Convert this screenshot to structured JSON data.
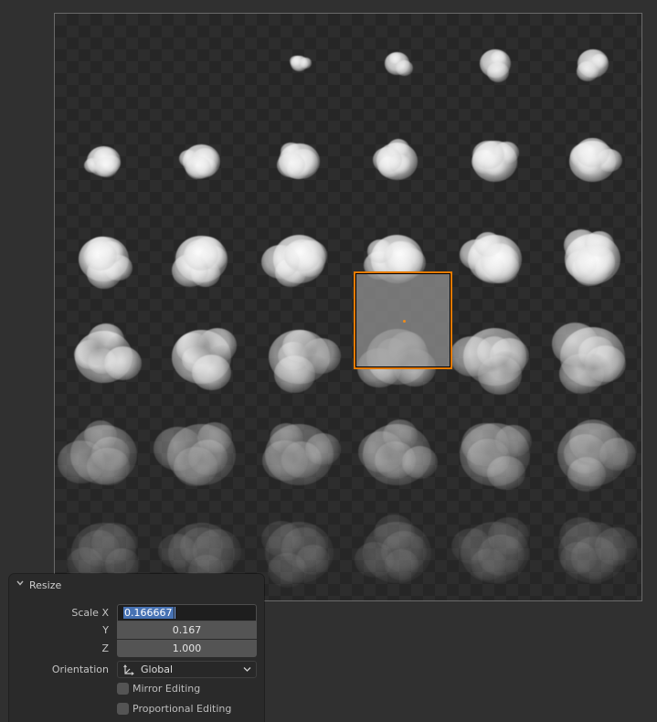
{
  "operator_panel": {
    "title": "Resize",
    "scale_x": {
      "label": "Scale X",
      "value": "0.166667"
    },
    "scale_y": {
      "label": "Y",
      "value": "0.167"
    },
    "scale_z": {
      "label": "Z",
      "value": "1.000"
    },
    "orientation": {
      "label": "Orientation",
      "value": "Global"
    },
    "mirror_editing": {
      "label": "Mirror Editing",
      "checked": false
    },
    "proportional_editing": {
      "label": "Proportional Editing",
      "checked": false
    }
  },
  "colors": {
    "selection_outline": "#e47a00",
    "active_text_selection": "#4772b3",
    "panel_background": "#2a2a2a",
    "field_background": "#545454"
  },
  "icons": {
    "panel_collapse": "chevron-down-icon",
    "orientation": "orientation-axes-icon",
    "dropdown": "chevron-down-icon"
  }
}
